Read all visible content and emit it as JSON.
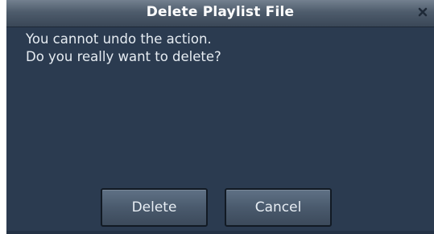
{
  "dialog": {
    "title": "Delete Playlist File",
    "close_icon": "close-icon",
    "message_lines": [
      "You cannot undo the action.",
      "Do you really want to delete?"
    ],
    "buttons": {
      "delete_label": "Delete",
      "cancel_label": "Cancel"
    }
  },
  "colors": {
    "dialog_background": "#2b3b50",
    "titlebar_gradient_top": "#73808f",
    "titlebar_gradient_bottom": "#3a4757",
    "button_gradient_top": "#5f7185",
    "button_gradient_bottom": "#3c4a5b",
    "text": "#e6ecf2"
  }
}
